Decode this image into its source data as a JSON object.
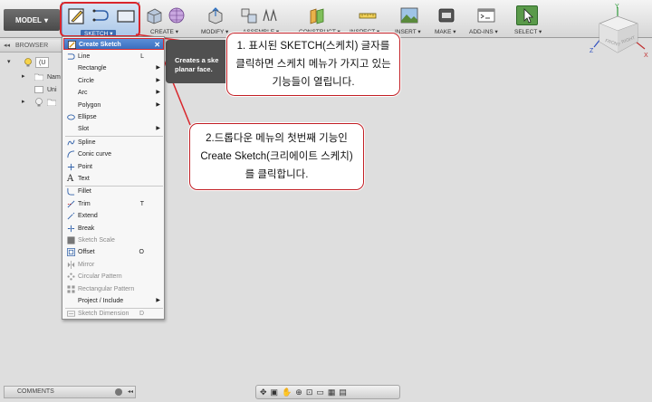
{
  "toolbar": {
    "model_label": "MODEL",
    "groups": [
      {
        "label": "SKETCH",
        "chevron": "▾"
      },
      {
        "label": "CREATE",
        "chevron": "▾"
      },
      {
        "label": "MODIFY",
        "chevron": "▾"
      },
      {
        "label": "ASSEMBLE",
        "chevron": "▾"
      },
      {
        "label": "CONSTRUCT",
        "chevron": "▾"
      },
      {
        "label": "INSPECT",
        "chevron": "▾"
      },
      {
        "label": "INSERT",
        "chevron": "▾"
      },
      {
        "label": "MAKE",
        "chevron": "▾"
      },
      {
        "label": "ADD-INS",
        "chevron": "▾"
      },
      {
        "label": "SELECT",
        "chevron": "▾"
      }
    ]
  },
  "browser": {
    "title": "BROWSER",
    "collapse_glyph": "◂◂",
    "root_label": "(U",
    "rows": [
      "Nam",
      "Uni",
      ""
    ]
  },
  "tooltip": {
    "line1": "Creates a ske",
    "line2": "planar face."
  },
  "menu": {
    "close_glyph": "✕",
    "items": [
      {
        "label": "Create Sketch",
        "icon": "create-sketch-icon",
        "highlighted": true
      },
      {
        "label": "Line",
        "icon": "line-icon",
        "key": "L"
      },
      {
        "label": "Rectangle",
        "icon": "",
        "submenu": true
      },
      {
        "label": "Circle",
        "icon": "",
        "submenu": true
      },
      {
        "label": "Arc",
        "icon": "",
        "submenu": true
      },
      {
        "label": "Polygon",
        "icon": "",
        "submenu": true
      },
      {
        "label": "Ellipse",
        "icon": "ellipse-icon"
      },
      {
        "label": "Slot",
        "icon": "",
        "submenu": true
      },
      {
        "label": "Spline",
        "icon": "spline-icon"
      },
      {
        "label": "Conic curve",
        "icon": "conic-icon"
      },
      {
        "label": "Point",
        "icon": "point-icon"
      },
      {
        "label": "Text",
        "icon": "text-icon"
      },
      {
        "label": "Fillet",
        "icon": "fillet-icon"
      },
      {
        "label": "Trim",
        "icon": "trim-icon",
        "key": "T"
      },
      {
        "label": "Extend",
        "icon": "extend-icon"
      },
      {
        "label": "Break",
        "icon": "break-icon"
      },
      {
        "label": "Sketch Scale",
        "icon": "sketch-scale-icon",
        "disabled": true
      },
      {
        "label": "Offset",
        "icon": "offset-icon",
        "key": "O"
      },
      {
        "label": "Mirror",
        "icon": "mirror-icon",
        "disabled": true
      },
      {
        "label": "Circular Pattern",
        "icon": "circular-pattern-icon",
        "disabled": true
      },
      {
        "label": "Rectangular Pattern",
        "icon": "rectangular-pattern-icon",
        "disabled": true
      },
      {
        "label": "Project / Include",
        "icon": "",
        "submenu": true
      },
      {
        "label": "Sketch Dimension",
        "icon": "sketch-dimension-icon",
        "key": "D",
        "disabled": true
      }
    ]
  },
  "callouts": {
    "c1": [
      "1. 표시된 SKETCH(스케치) 글자를",
      "클릭하면 스케치 메뉴가 가지고 있는",
      "기능들이 열립니다."
    ],
    "c2": [
      "2.드롭다운 메뉴의 첫번째 기능인",
      "Create Sketch(크리에이트 스케치)",
      "를 클릭합니다."
    ]
  },
  "viewcube": {
    "axis_y": "Y",
    "axis_z": "Z",
    "axis_x": "X",
    "face_front": "FRONT",
    "face_right": "RIGHT"
  },
  "bottom": {
    "comments_label": "COMMENTS",
    "comments_glyph": "◂◂"
  },
  "colors": {
    "annotation_red": "#d9262c",
    "highlight_blue": "#3b6fbf"
  }
}
